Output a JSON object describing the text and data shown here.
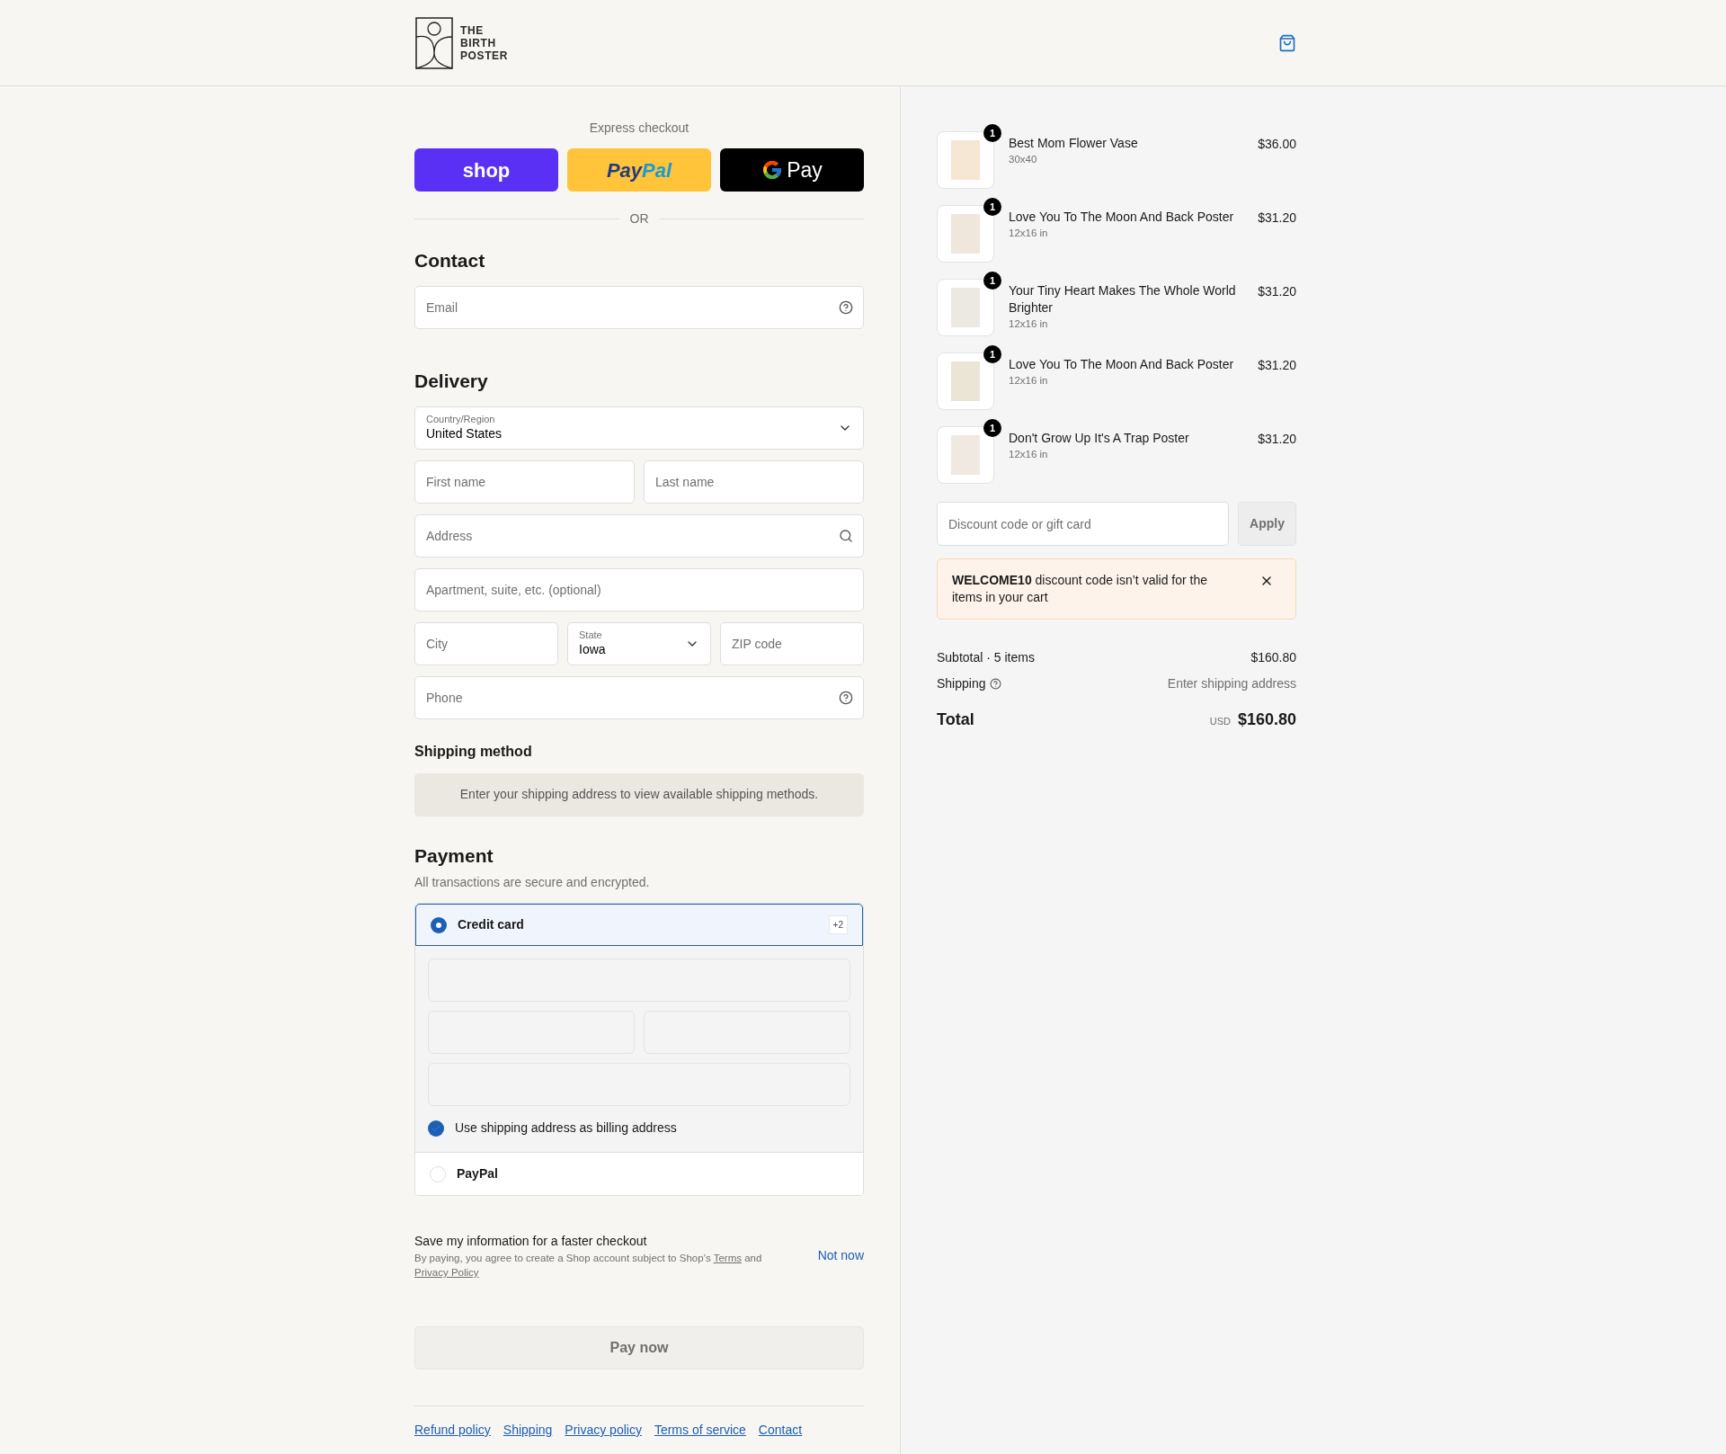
{
  "header": {
    "logo_lines": [
      "THE",
      "BIRTH",
      "POSTER"
    ]
  },
  "express": {
    "title": "Express checkout",
    "buttons": [
      {
        "kind": "shop",
        "label": "shop"
      },
      {
        "kind": "paypal",
        "label_parts": [
          "Pay",
          "Pal"
        ]
      },
      {
        "kind": "gpay",
        "label": "Pay"
      }
    ],
    "divider": "OR"
  },
  "contact": {
    "title": "Contact",
    "email": {
      "placeholder": "Email"
    }
  },
  "delivery": {
    "title": "Delivery",
    "rows": [
      [
        {
          "kind": "select",
          "label": "Country/Region",
          "value": "United States"
        }
      ],
      [
        {
          "kind": "text",
          "placeholder": "First name"
        },
        {
          "kind": "text",
          "placeholder": "Last name"
        }
      ],
      [
        {
          "kind": "search",
          "placeholder": "Address"
        }
      ],
      [
        {
          "kind": "text",
          "placeholder": "Apartment, suite, etc. (optional)"
        }
      ],
      [
        {
          "kind": "text",
          "placeholder": "City"
        },
        {
          "kind": "select",
          "label": "State",
          "value": "Iowa"
        },
        {
          "kind": "text",
          "placeholder": "ZIP code"
        }
      ],
      [
        {
          "kind": "help",
          "placeholder": "Phone"
        }
      ]
    ]
  },
  "shipping_method": {
    "title": "Shipping method",
    "notice": "Enter your shipping address to view available shipping methods."
  },
  "payment": {
    "title": "Payment",
    "subtitle": "All transactions are secure and encrypted.",
    "methods": [
      {
        "label": "Credit card",
        "selected": true,
        "badge": "+2"
      },
      {
        "label": "PayPal",
        "selected": false
      }
    ],
    "billing": {
      "label": "Use shipping address as billing address",
      "checked": true
    }
  },
  "save_info": {
    "title": "Save my information for a faster checkout",
    "consent": [
      {
        "kind": "text",
        "text": "By paying, you agree to create a Shop account subject to Shop’s"
      },
      {
        "kind": "link",
        "text": "Terms"
      },
      {
        "kind": "text",
        "text": "and"
      },
      {
        "kind": "link",
        "text": "Privacy Policy"
      }
    ],
    "action": "Not now"
  },
  "pay_button": "Pay now",
  "footer_links": [
    "Refund policy",
    "Shipping",
    "Privacy policy",
    "Terms of service",
    "Contact"
  ],
  "cart": {
    "items": [
      {
        "name": "Best Mom Flower Vase",
        "variant": "30x40",
        "price": "$36.00",
        "quantity": "1"
      },
      {
        "name": "Love You To The Moon And Back Poster",
        "variant": "12x16 in",
        "price": "$31.20",
        "quantity": "1"
      },
      {
        "name": "Your Tiny Heart Makes The Whole World Brighter",
        "variant": "12x16 in",
        "price": "$31.20",
        "quantity": "1"
      },
      {
        "name": "Love You To The Moon And Back Poster",
        "variant": "12x16 in",
        "price": "$31.20",
        "quantity": "1"
      },
      {
        "name": "Don't Grow Up It's A Trap Poster",
        "variant": "12x16 in",
        "price": "$31.20",
        "quantity": "1"
      }
    ],
    "discount": {
      "placeholder": "Discount code or gift card",
      "button": "Apply"
    },
    "alert": "**WELCOME10** discount code isn’t valid for the items in your cart",
    "subtotal": {
      "label": "Subtotal · 5 items",
      "value": "$160.80"
    },
    "shipping": {
      "label": "Shipping",
      "value": "Enter shipping address"
    },
    "total": {
      "label": "Total",
      "currency": "USD",
      "value": "$160.80"
    }
  }
}
